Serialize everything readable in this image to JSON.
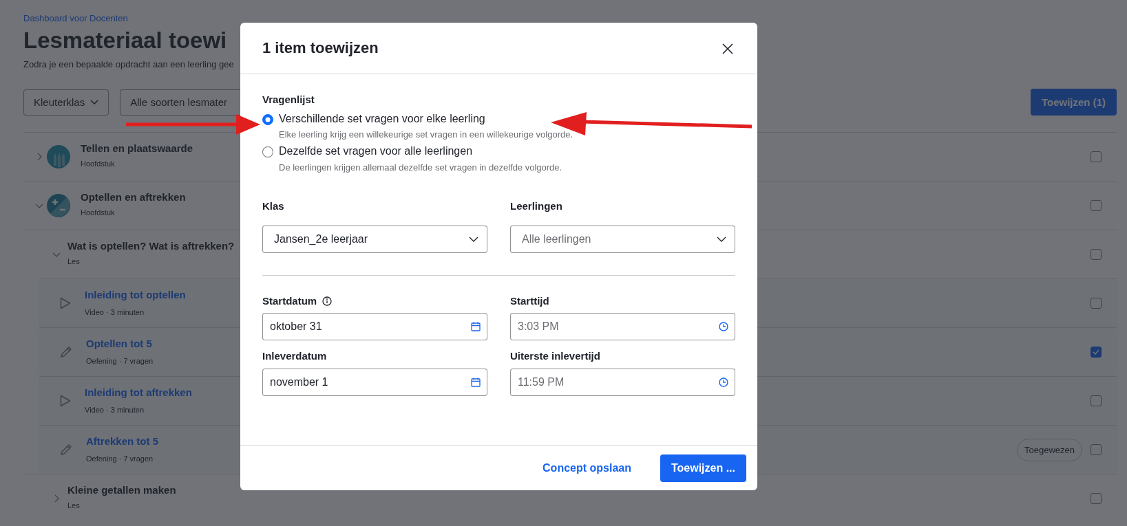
{
  "page": {
    "breadcrumb": "Dashboard voor Docenten",
    "title": "Lesmateriaal toewi",
    "subtitle": "Zodra je een bepaalde opdracht aan een leerling gee",
    "filters": [
      {
        "label": "Kleuterklas",
        "caret": true
      },
      {
        "label": "Alle soorten lesmater",
        "caret": false
      }
    ],
    "assign_button": "Toewijzen (1)",
    "rows": [
      {
        "kind": "chapter",
        "title": "Tellen en plaatswaarde",
        "subtitle": "Hoofdstuk",
        "expanded": false,
        "checked": false
      },
      {
        "kind": "chapter",
        "title": "Optellen en aftrekken",
        "subtitle": "Hoofdstuk",
        "expanded": true,
        "checked": false,
        "children": [
          {
            "kind": "lesson",
            "title": "Wat is optellen? Wat is aftrekken?",
            "subtitle": "Les",
            "expanded": true,
            "checked": false,
            "children": [
              {
                "kind": "video",
                "title": "Inleiding tot optellen",
                "subtitle": "Video · 3 minuten",
                "checked": false
              },
              {
                "kind": "exercise",
                "title": "Optellen tot 5",
                "subtitle": "Oefening · 7 vragen",
                "checked": true
              },
              {
                "kind": "video",
                "title": "Inleiding tot aftrekken",
                "subtitle": "Video · 3 minuten",
                "checked": false
              },
              {
                "kind": "exercise",
                "title": "Aftrekken tot 5",
                "subtitle": "Oefening · 7 vragen",
                "checked": false,
                "badge": "Toegewezen"
              }
            ]
          },
          {
            "kind": "lesson",
            "title": "Kleine getallen maken",
            "subtitle": "Les",
            "expanded": false,
            "checked": false
          }
        ]
      }
    ]
  },
  "modal": {
    "title": "1 item toewijzen",
    "questionnaire": {
      "label": "Vragenlijst",
      "options": [
        {
          "label": "Verschillende set vragen voor elke leerling",
          "description": "Elke leerling krijg een willekeurige set vragen in een willekeurige volgorde.",
          "selected": true
        },
        {
          "label": "Dezelfde set vragen voor alle leerlingen",
          "description": "De leerlingen krijgen allemaal dezelfde set vragen in dezelfde volgorde.",
          "selected": false
        }
      ]
    },
    "selects": [
      {
        "label": "Klas",
        "value": "Jansen_2e leerjaar"
      },
      {
        "label": "Leerlingen",
        "placeholder": "Alle leerlingen"
      }
    ],
    "fields": [
      {
        "kind": "date",
        "label": "Startdatum",
        "info": true,
        "value": "oktober 31"
      },
      {
        "kind": "time",
        "label": "Starttijd",
        "placeholder": "3:03 PM"
      },
      {
        "kind": "date",
        "label": "Inleverdatum",
        "value": "november 1"
      },
      {
        "kind": "time",
        "label": "Uiterste inlevertijd",
        "placeholder": "11:59 PM"
      }
    ],
    "secondary_button": "Concept opslaan",
    "primary_button": "Toewijzen ..."
  }
}
